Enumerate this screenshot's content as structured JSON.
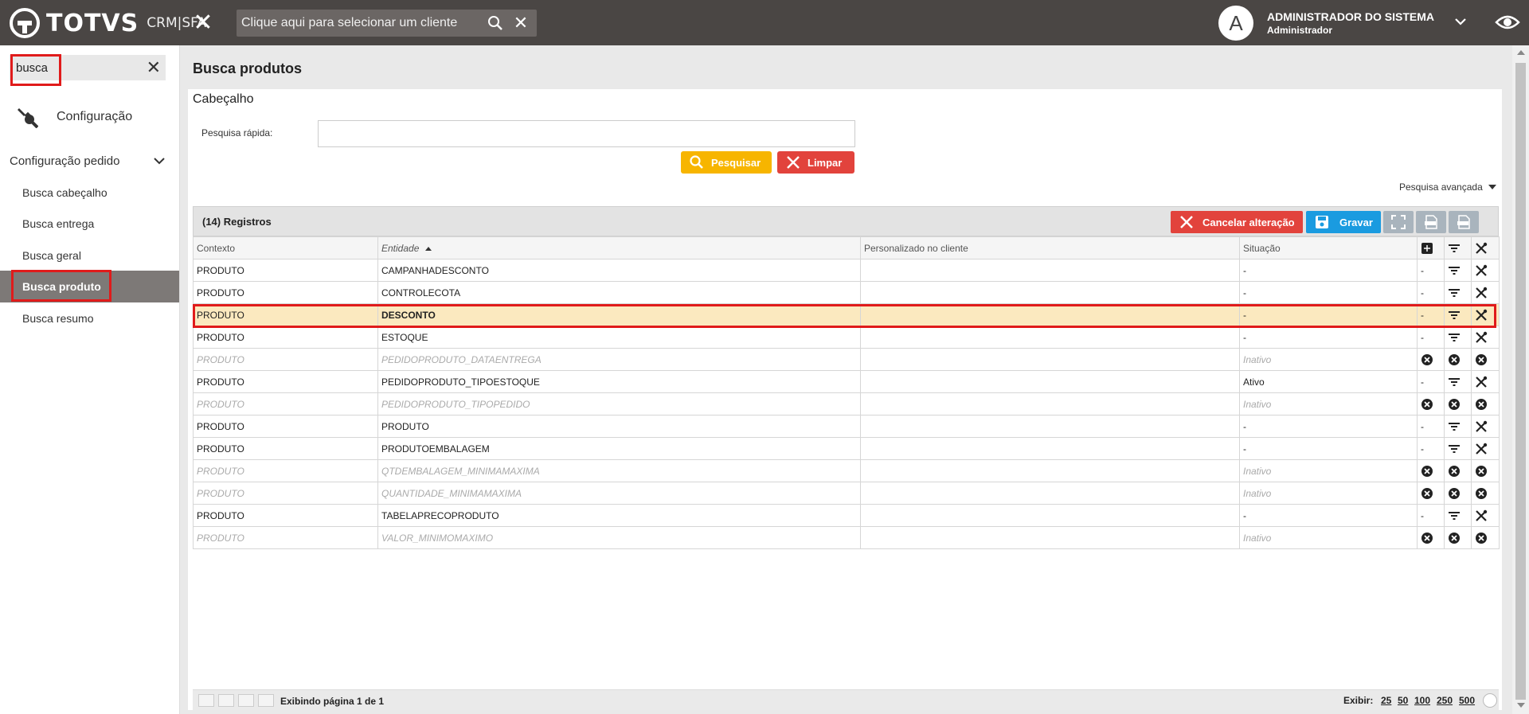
{
  "app": {
    "brand": "TOTVS",
    "product": "CRM|SFA",
    "client_search_placeholder": "Clique aqui para selecionar um cliente",
    "user_initial": "A",
    "user_name": "ADMINISTRADOR DO SISTEMA",
    "user_role": "Administrador"
  },
  "sidebar": {
    "search_value": "busca",
    "config_label": "Configuração",
    "group_label": "Configuração pedido",
    "items": [
      {
        "label": "Busca cabeçalho",
        "active": false
      },
      {
        "label": "Busca entrega",
        "active": false
      },
      {
        "label": "Busca geral",
        "active": false
      },
      {
        "label": "Busca produto",
        "active": true
      },
      {
        "label": "Busca resumo",
        "active": false
      }
    ]
  },
  "main": {
    "title": "Busca produtos",
    "section": "Cabeçalho",
    "quick_search_label": "Pesquisa rápida:",
    "quick_search_value": "",
    "search_button": "Pesquisar",
    "clear_button": "Limpar",
    "advanced_search": "Pesquisa avançada"
  },
  "grid": {
    "records": "(14) Registros",
    "cancel_button": "Cancelar alteração",
    "save_button": "Gravar",
    "columns": [
      "Contexto",
      "Entidade",
      "Personalizado no cliente",
      "Situação"
    ],
    "rows": [
      {
        "contexto": "PRODUTO",
        "entidade": "CAMPANHADESCONTO",
        "personalizado": "",
        "situacao": "-",
        "state": "normal"
      },
      {
        "contexto": "PRODUTO",
        "entidade": "CONTROLECOTA",
        "personalizado": "",
        "situacao": "-",
        "state": "normal"
      },
      {
        "contexto": "PRODUTO",
        "entidade": "DESCONTO",
        "personalizado": "",
        "situacao": "-",
        "state": "selected"
      },
      {
        "contexto": "PRODUTO",
        "entidade": "ESTOQUE",
        "personalizado": "",
        "situacao": "-",
        "state": "normal"
      },
      {
        "contexto": "PRODUTO",
        "entidade": "PEDIDOPRODUTO_DATAENTREGA",
        "personalizado": "",
        "situacao": "Inativo",
        "state": "inactive"
      },
      {
        "contexto": "PRODUTO",
        "entidade": "PEDIDOPRODUTO_TIPOESTOQUE",
        "personalizado": "",
        "situacao": "Ativo",
        "state": "normal"
      },
      {
        "contexto": "PRODUTO",
        "entidade": "PEDIDOPRODUTO_TIPOPEDIDO",
        "personalizado": "",
        "situacao": "Inativo",
        "state": "inactive"
      },
      {
        "contexto": "PRODUTO",
        "entidade": "PRODUTO",
        "personalizado": "",
        "situacao": "-",
        "state": "normal"
      },
      {
        "contexto": "PRODUTO",
        "entidade": "PRODUTOEMBALAGEM",
        "personalizado": "",
        "situacao": "-",
        "state": "normal"
      },
      {
        "contexto": "PRODUTO",
        "entidade": "QTDEMBALAGEM_MINIMAMAXIMA",
        "personalizado": "",
        "situacao": "Inativo",
        "state": "inactive"
      },
      {
        "contexto": "PRODUTO",
        "entidade": "QUANTIDADE_MINIMAMAXIMA",
        "personalizado": "",
        "situacao": "Inativo",
        "state": "inactive"
      },
      {
        "contexto": "PRODUTO",
        "entidade": "TABELAPRECOPRODUTO",
        "personalizado": "",
        "situacao": "-",
        "state": "normal"
      },
      {
        "contexto": "PRODUTO",
        "entidade": "VALOR_MINIMOMAXIMO",
        "personalizado": "",
        "situacao": "Inativo",
        "state": "inactive"
      }
    ],
    "dash": "-"
  },
  "footer": {
    "page_info": "Exibindo página 1 de 1",
    "show_label": "Exibir:",
    "page_sizes": [
      "25",
      "50",
      "100",
      "250",
      "500"
    ]
  },
  "colors": {
    "topbar": "#4a4644",
    "search_button": "#f7b500",
    "danger": "#e2433c",
    "save": "#1a9be0",
    "selected_row": "#fbe9bf",
    "highlight": "#e01b1b"
  }
}
